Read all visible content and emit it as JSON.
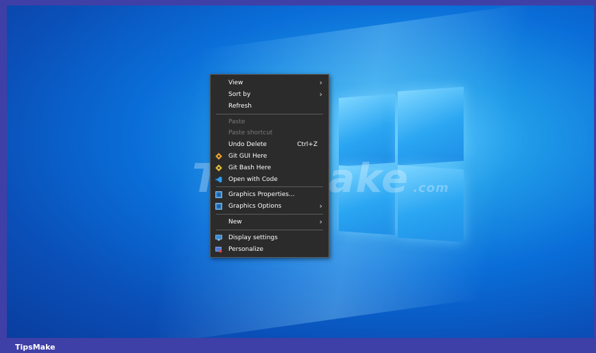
{
  "watermark": {
    "text": "TipsMake",
    "suffix": ".com"
  },
  "footer": {
    "brand": "TipsMake"
  },
  "context_menu": {
    "view": "View",
    "sort_by": "Sort by",
    "refresh": "Refresh",
    "paste": "Paste",
    "paste_shortcut": "Paste shortcut",
    "undo_delete": "Undo Delete",
    "undo_shortcut": "Ctrl+Z",
    "git_gui": "Git GUI Here",
    "git_bash": "Git Bash Here",
    "open_with_code": "Open with Code",
    "graphics_properties": "Graphics Properties...",
    "graphics_options": "Graphics Options",
    "new": "New",
    "display_settings": "Display settings",
    "personalize": "Personalize",
    "submenu_arrow": "›"
  },
  "icons": {
    "git_gui": "git-icon",
    "git_bash": "git-icon",
    "open_with_code": "vscode-icon",
    "graphics_properties": "intel-graphics-icon",
    "graphics_options": "intel-graphics-icon",
    "display_settings": "monitor-icon",
    "personalize": "personalize-icon"
  },
  "colors": {
    "menu_bg": "#2b2b2b",
    "desktop_blue": "#0a6ed8",
    "frame": "#3f3fa8"
  }
}
